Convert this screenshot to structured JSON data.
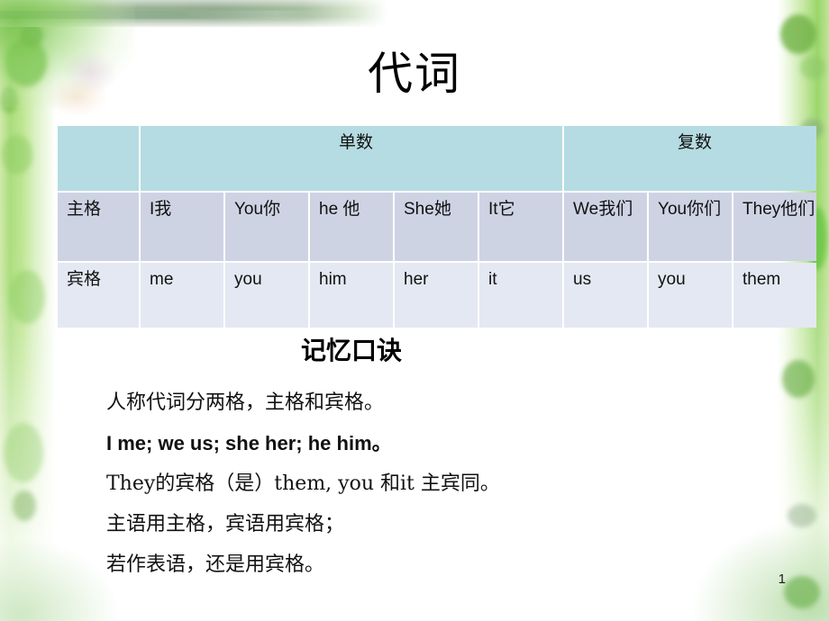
{
  "slide": {
    "title": "代词",
    "page_number": "1"
  },
  "table": {
    "header": {
      "corner": "",
      "singular": "单数",
      "plural": "复数"
    },
    "rows": [
      {
        "label": "主格",
        "cells": [
          {
            "en": "I",
            "cn": "我",
            "color": "#111111"
          },
          {
            "en": "You",
            "cn": "你",
            "color": "#ff0000"
          },
          {
            "en": "he ",
            "cn": "他",
            "color": "#111111"
          },
          {
            "en": "She",
            "cn": "她",
            "color": "#111111"
          },
          {
            "en": "It",
            "cn": "它",
            "color": "#ff0000"
          },
          {
            "en": "We",
            "cn": "我们",
            "color": "#111111"
          },
          {
            "en": "You",
            "cn": "你们",
            "color": "#ff0000"
          },
          {
            "en": "They",
            "cn": "他们",
            "color": "#111111"
          }
        ]
      },
      {
        "label": "宾格",
        "cells": [
          {
            "en": "me",
            "cn": "",
            "color": "#111111"
          },
          {
            "en": "you",
            "cn": "",
            "color": "#ff0000"
          },
          {
            "en": "him",
            "cn": "",
            "color": "#111111"
          },
          {
            "en": "her",
            "cn": "",
            "color": "#111111"
          },
          {
            "en": "it",
            "cn": "",
            "color": "#ff0000"
          },
          {
            "en": "us",
            "cn": "",
            "color": "#111111"
          },
          {
            "en": "you",
            "cn": "",
            "color": "#ff0000"
          },
          {
            "en": "them",
            "cn": "",
            "color": "#111111"
          }
        ]
      }
    ]
  },
  "verse": {
    "title": "记忆口诀",
    "lines": [
      "人称代词分两格，主格和宾格。",
      "I me; we us; she her; he him。",
      "They的宾格（是）them, you 和it 主宾同。",
      "主语用主格，宾语用宾格；",
      "若作表语，还是用宾格。"
    ]
  },
  "colors": {
    "header_teal": "#b5dce2",
    "row1_lavender": "#ced3e4",
    "row2_lavender_light": "#e4e8f2",
    "accent_red": "#ff0000",
    "deco_green": "#8ecb66"
  }
}
